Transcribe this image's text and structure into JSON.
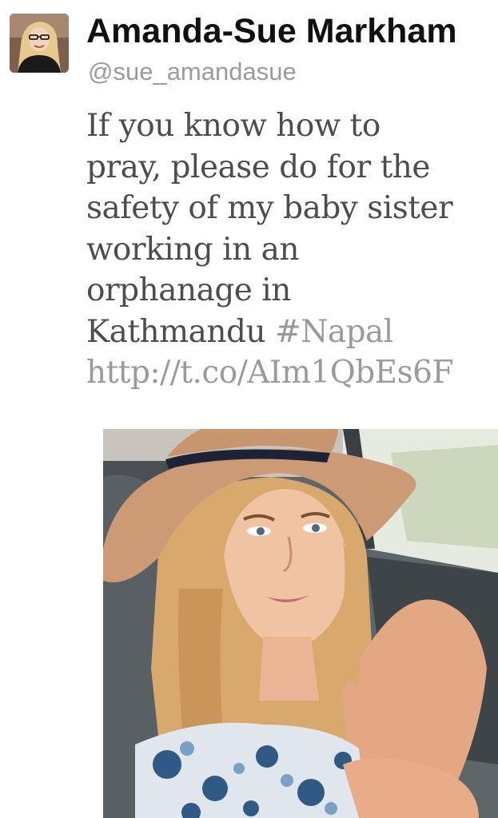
{
  "tweet": {
    "author": {
      "display_name": "Amanda-Sue Markham",
      "handle": "@sue_amandasue",
      "avatar_icon": "user-avatar-photo"
    },
    "text_lines": [
      "If you know how to",
      "pray, please do for the",
      "safety of my baby sister",
      "working in an",
      "orphanage in"
    ],
    "last_line_text": "Kathmandu",
    "hashtag": "#Napal",
    "link": "http://t.co/AIm1QbEs6F",
    "media": {
      "type": "photo"
    }
  },
  "colors": {
    "name": "#111111",
    "handle": "#9b9b9b",
    "body_text": "#4d4d4d",
    "link": "#9a9a9a"
  }
}
